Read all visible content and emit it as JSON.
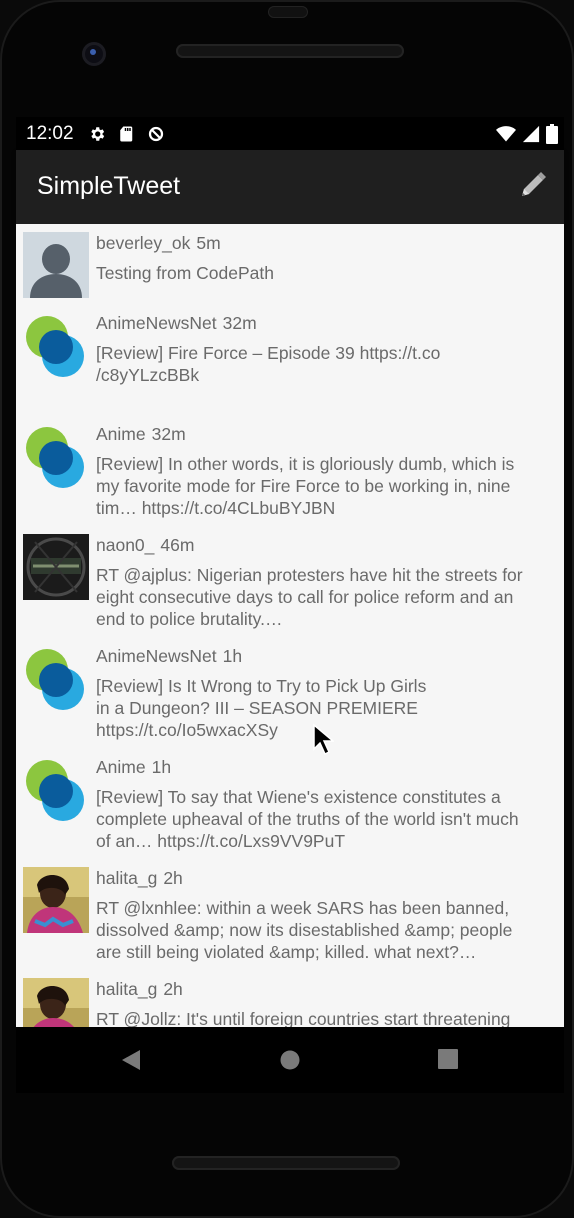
{
  "status_bar": {
    "time": "12:02"
  },
  "app_bar": {
    "title": "SimpleTweet"
  },
  "colors": {
    "app_bar": "#1f1f1f",
    "feed_bg": "#f6f6f6",
    "text": "#6a6a6a"
  },
  "tweets": [
    {
      "handle": "beverley_ok",
      "time": "5m",
      "text": "Testing from CodePath",
      "avatar": "default-person"
    },
    {
      "handle": "AnimeNewsNet",
      "time": "32m",
      "text": "[Review] Fire Force – Episode 39 https://t.co\n/c8yYLzcBBk",
      "avatar": "ann-logo"
    },
    {
      "handle": "Anime",
      "time": "32m",
      "text": "[Review] In other words, it is gloriously dumb, which is\nmy favorite mode for Fire Force to be working in, nine\ntim… https://t.co/4CLbuBYJBN",
      "avatar": "ann-logo"
    },
    {
      "handle": "naon0_",
      "time": "46m",
      "text": "RT @ajplus: Nigerian protesters have hit the streets for\neight consecutive days to call for police reform and an\nend to police brutality.…",
      "avatar": "dark-photo"
    },
    {
      "handle": "AnimeNewsNet",
      "time": "1h",
      "text": "[Review] Is It Wrong to Try to Pick Up Girls\nin a Dungeon? III – SEASON PREMIERE\nhttps://t.co/Io5wxacXSy",
      "avatar": "ann-logo"
    },
    {
      "handle": "Anime",
      "time": "1h",
      "text": "[Review] To say that Wiene's existence constitutes a\ncomplete upheaval of the truths of the world isn't much\nof an… https://t.co/Lxs9VV9PuT",
      "avatar": "ann-logo"
    },
    {
      "handle": "halita_g",
      "time": "2h",
      "text": "RT @lxnhlee: within a week SARS has been banned,\ndissolved &amp; now its disestablished &amp; people\nare still being violated &amp; killed. what next?…",
      "avatar": "person-photo"
    },
    {
      "handle": "halita_g",
      "time": "2h",
      "text": "RT @Jollz: It's until foreign countries start threatening\nto block visas and seize assets we will start seeing",
      "avatar": "person-photo"
    }
  ]
}
